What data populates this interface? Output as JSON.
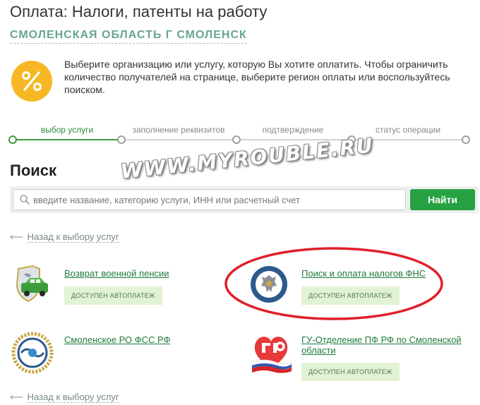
{
  "header": {
    "title": "Оплата: Налоги, патенты на работу",
    "region": "СМОЛЕНСКАЯ ОБЛАСТЬ Г СМОЛЕНСК"
  },
  "info": {
    "icon": "percent-icon",
    "text": "Выберите организацию или услугу, которую Вы хотите оплатить. Чтобы ограничить количество получателей на странице, выберите регион оплаты или воспользуйтесь поиском."
  },
  "steps": [
    {
      "label": "выбор услуги",
      "active": true
    },
    {
      "label": "заполнение реквизитов",
      "active": false
    },
    {
      "label": "подтверждение",
      "active": false
    },
    {
      "label": "статус операции",
      "active": false
    }
  ],
  "search": {
    "heading": "Поиск",
    "placeholder": "введите название, категорию услуги, ИНН или расчетный счет",
    "button_label": "Найти"
  },
  "back_link": "Назад к выбору услуг",
  "services": [
    {
      "name": "Возврат военной пенсии",
      "badge": "ДОСТУПЕН АВТОПЛАТЕЖ",
      "logo": "military-pension-logo"
    },
    {
      "name": "Поиск и оплата налогов ФНС",
      "badge": "ДОСТУПЕН АВТОПЛАТЕЖ",
      "logo": "fns-logo"
    },
    {
      "name": "Смоленское РО ФСС РФ",
      "badge": "",
      "logo": "fss-logo"
    },
    {
      "name": "ГУ-Отделение ПФ РФ по Смоленской области",
      "badge": "ДОСТУПЕН АВТОПЛАТЕЖ",
      "logo": "pfr-logo"
    }
  ],
  "watermark": "WWW.MYROUBLE.RU",
  "colors": {
    "accent_green": "#27a243",
    "link_green": "#1f7a3c",
    "region_green": "#67a78b",
    "icon_yellow": "#f6b824",
    "highlight_red": "#e0202a"
  }
}
